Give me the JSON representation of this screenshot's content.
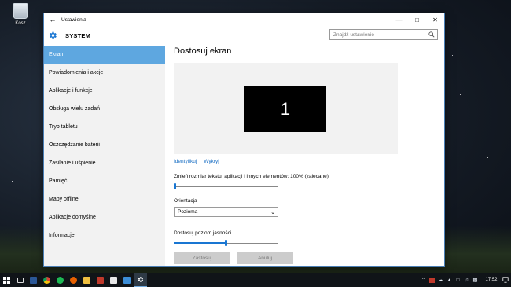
{
  "desktop": {
    "recycle_bin_label": "Kosz"
  },
  "window": {
    "title": "Ustawienia",
    "section_title": "SYSTEM",
    "search_placeholder": "Znajdź ustawienie"
  },
  "sidebar": {
    "items": [
      {
        "label": "Ekran",
        "active": true
      },
      {
        "label": "Powiadomienia i akcje"
      },
      {
        "label": "Aplikacje i funkcje"
      },
      {
        "label": "Obsługa wielu zadań"
      },
      {
        "label": "Tryb tabletu"
      },
      {
        "label": "Oszczędzanie baterii"
      },
      {
        "label": "Zasilanie i uśpienie"
      },
      {
        "label": "Pamięć"
      },
      {
        "label": "Mapy offline"
      },
      {
        "label": "Aplikacje domyślne"
      },
      {
        "label": "Informacje"
      }
    ]
  },
  "content": {
    "heading": "Dostosuj ekran",
    "monitor_number": "1",
    "identify_link": "Identyfikuj",
    "detect_link": "Wykryj",
    "scale_label": "Zmień rozmiar tekstu, aplikacji i innych elementów: 100% (zalecane)",
    "scale_value": 0,
    "orientation_label": "Orientacja",
    "orientation_value": "Pozioma",
    "brightness_label": "Dostosuj poziom jasności",
    "brightness_value": 0.5,
    "apply_button": "Zastosuj",
    "cancel_button": "Anuluj"
  },
  "taskbar": {
    "clock": "17:52",
    "apps": [
      "start",
      "task-view",
      "word",
      "chrome",
      "spotify",
      "firefox",
      "explorer",
      "paint",
      "store",
      "mail",
      "settings"
    ]
  },
  "colors": {
    "accent": "#1976d2",
    "sidebar_active": "#5ea7e0",
    "link": "#1a6fc4",
    "taskbar": "#101418"
  }
}
